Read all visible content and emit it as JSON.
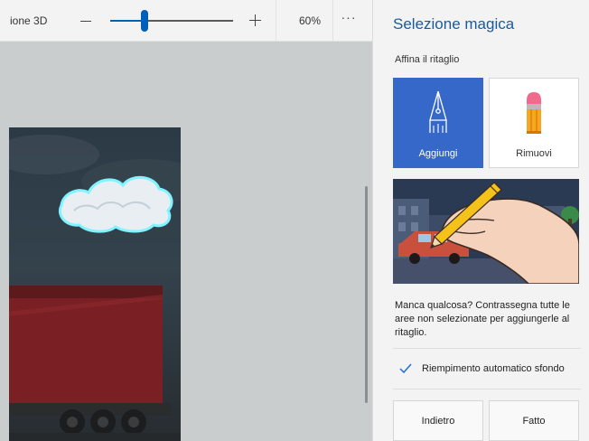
{
  "toolbar": {
    "title": "ione 3D",
    "zoom_percent": "60%",
    "zoom_slider_fraction": 0.28,
    "more_label": "···"
  },
  "panel": {
    "title": "Selezione magica",
    "subtitle": "Affina il ritaglio",
    "add_label": "Aggiungi",
    "remove_label": "Rimuovi",
    "help_text": "Manca qualcosa? Contrassegna tutte le aree non selezionate per aggiungerle al ritaglio.",
    "autofill_label": "Riempimento automatico sfondo",
    "autofill_checked": true,
    "back_label": "Indietro",
    "done_label": "Fatto"
  },
  "colors": {
    "accent": "#3568c9",
    "title_blue": "#1a5a9a",
    "slider_blue": "#005fb8",
    "canvas_bg": "#c9cdce"
  },
  "icons": {
    "add": "pen-nib-icon",
    "remove": "eraser-icon",
    "check": "checkmark-icon",
    "zoom_out": "minus-icon",
    "zoom_in": "plus-icon"
  }
}
